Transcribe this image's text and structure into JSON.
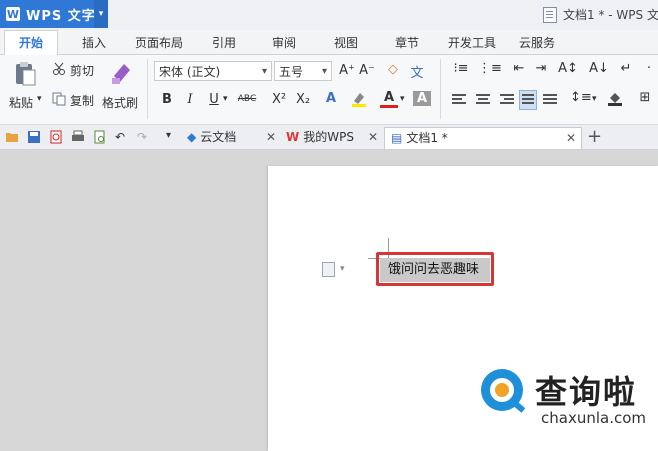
{
  "app": {
    "name": "WPS 文字",
    "logo_letter": "W",
    "window_title": "文档1 * - WPS 文"
  },
  "ribbon_tabs": [
    "开始",
    "插入",
    "页面布局",
    "引用",
    "审阅",
    "视图",
    "章节",
    "开发工具",
    "云服务"
  ],
  "clipboard": {
    "paste": "粘贴",
    "cut": "剪切",
    "copy": "复制",
    "format_painter": "格式刷"
  },
  "font": {
    "family": "宋体 (正文)",
    "size": "五号"
  },
  "format_buttons": {
    "bold": "B",
    "italic": "I",
    "underline": "U",
    "strike": "ABC",
    "superscript": "X²",
    "subscript": "X₂",
    "grow": "A⁺",
    "shrink": "A⁻"
  },
  "doc_tabs": [
    {
      "label": "云文档",
      "closable": true
    },
    {
      "label": "我的WPS",
      "closable": true
    },
    {
      "label": "文档1 *",
      "closable": true,
      "active": true
    }
  ],
  "new_tab": "+",
  "document": {
    "selected_text": "饿问问去恶趣味"
  },
  "watermark": {
    "cn": "查询啦",
    "en": "chaxunla.com"
  },
  "colors": {
    "accent": "#2f78d6",
    "highlight_box": "#d63636",
    "selection": "#c9c9c9"
  }
}
